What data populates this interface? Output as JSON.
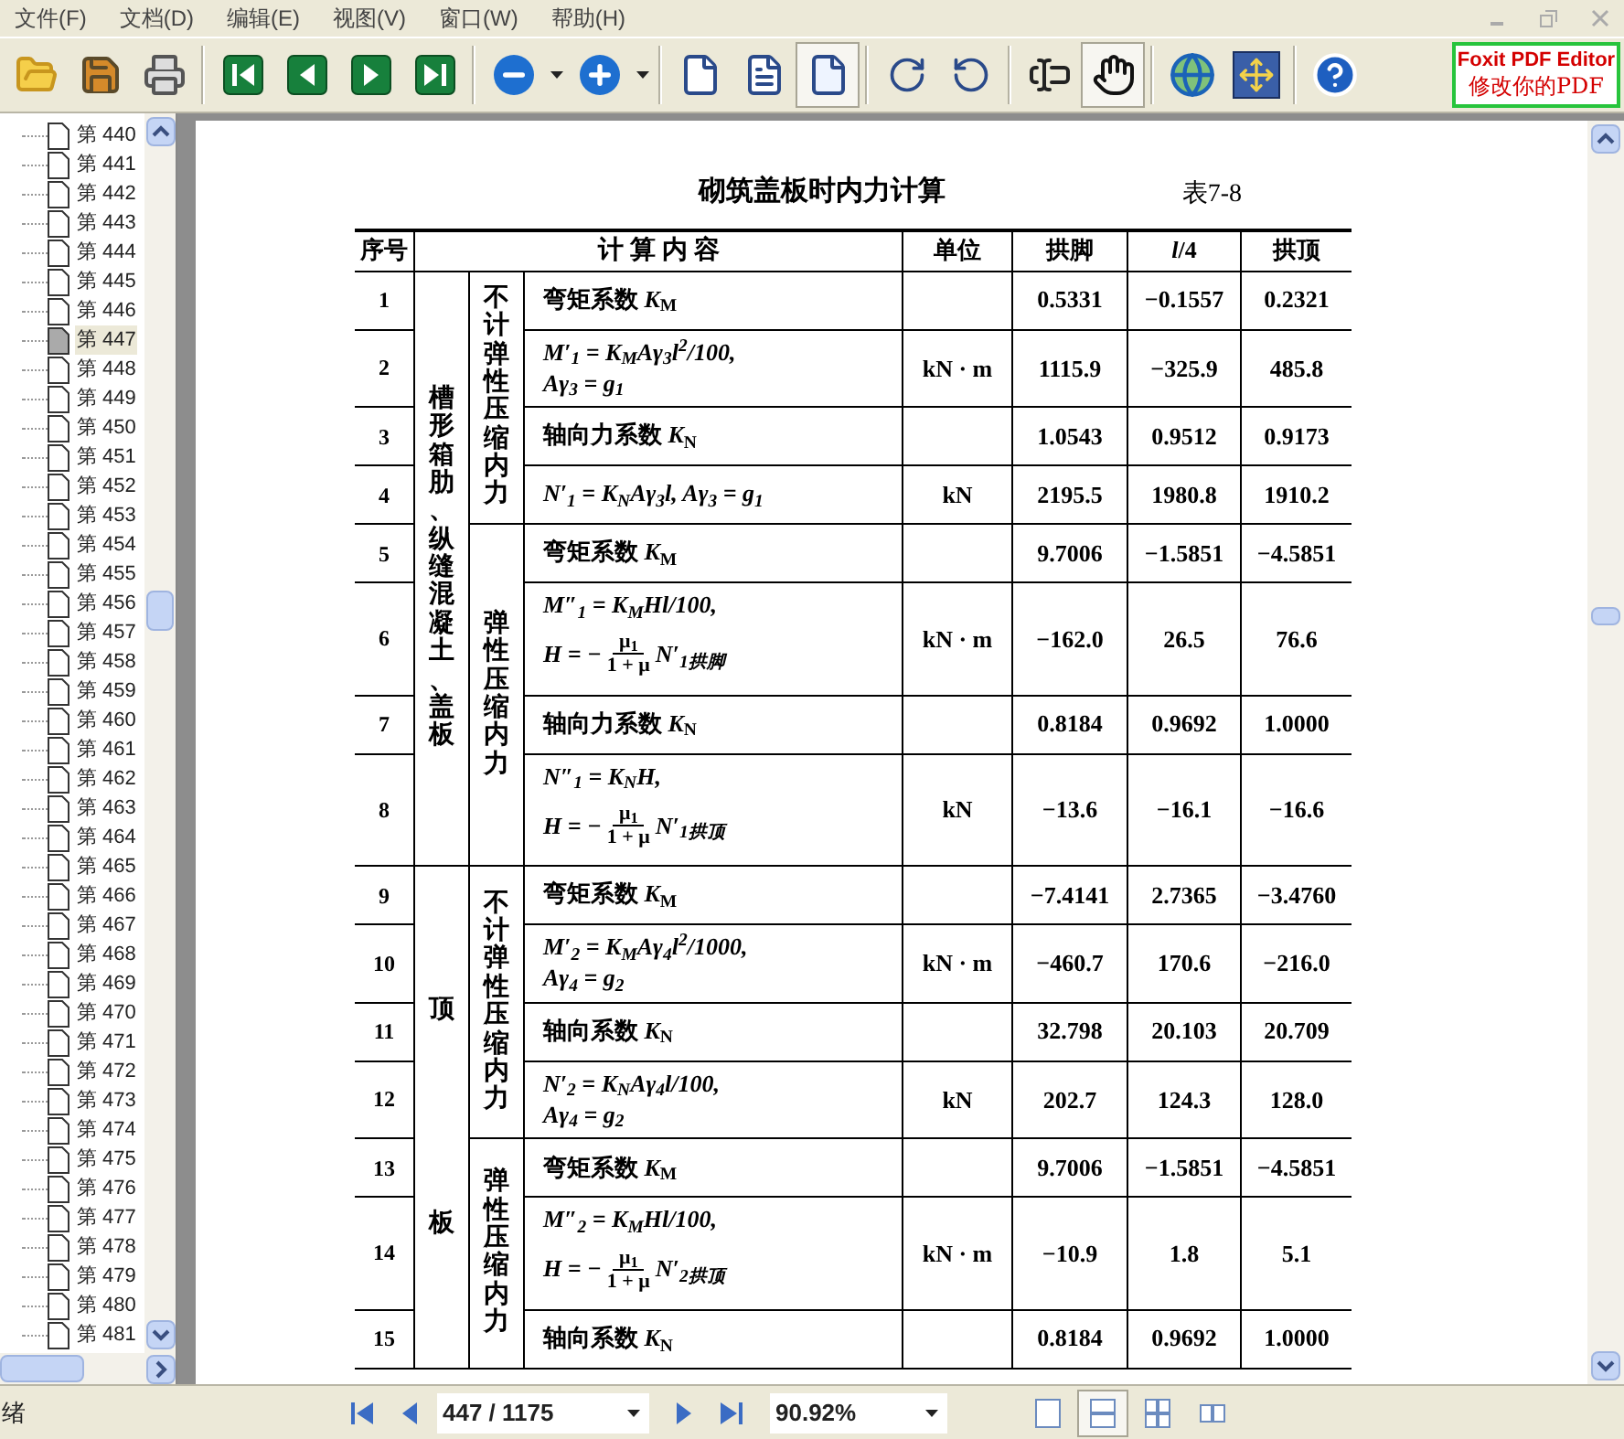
{
  "menu": [
    {
      "label": "文件(F)"
    },
    {
      "label": "文档(D)"
    },
    {
      "label": "编辑(E)"
    },
    {
      "label": "视图(V)"
    },
    {
      "label": "窗口(W)"
    },
    {
      "label": "帮助(H)"
    }
  ],
  "toolbar": [
    {
      "kind": "open",
      "pressed": false
    },
    {
      "kind": "save",
      "pressed": false
    },
    {
      "kind": "print",
      "pressed": false
    },
    {
      "kind": "separator"
    },
    {
      "kind": "first",
      "pressed": false
    },
    {
      "kind": "prev",
      "pressed": false
    },
    {
      "kind": "next",
      "pressed": false
    },
    {
      "kind": "last",
      "pressed": false
    },
    {
      "kind": "separator"
    },
    {
      "kind": "zoom_out",
      "pressed": false
    },
    {
      "kind": "dropdown",
      "pressed": false
    },
    {
      "kind": "zoom_in",
      "pressed": false
    },
    {
      "kind": "dropdown",
      "pressed": false
    },
    {
      "kind": "separator"
    },
    {
      "kind": "actual_size",
      "pressed": false
    },
    {
      "kind": "fit_page",
      "pressed": false
    },
    {
      "kind": "fit_width",
      "pressed": true
    },
    {
      "kind": "separator"
    },
    {
      "kind": "rotate_right",
      "pressed": false
    },
    {
      "kind": "rotate_left",
      "pressed": false
    },
    {
      "kind": "separator"
    },
    {
      "kind": "select_text",
      "pressed": false
    },
    {
      "kind": "hand",
      "pressed": true
    },
    {
      "kind": "separator"
    },
    {
      "kind": "web",
      "pressed": false
    },
    {
      "kind": "snapshot",
      "pressed": false
    },
    {
      "kind": "separator"
    },
    {
      "kind": "help",
      "pressed": false
    }
  ],
  "promo": {
    "title": "Foxit PDF Editor",
    "subtitle": "修改你的PDF"
  },
  "sidebar": {
    "items": [
      {
        "label": "第 440",
        "selected": false
      },
      {
        "label": "第 441",
        "selected": false
      },
      {
        "label": "第 442",
        "selected": false
      },
      {
        "label": "第 443",
        "selected": false
      },
      {
        "label": "第 444",
        "selected": false
      },
      {
        "label": "第 445",
        "selected": false
      },
      {
        "label": "第 446",
        "selected": false
      },
      {
        "label": "第 447",
        "selected": true
      },
      {
        "label": "第 448",
        "selected": false
      },
      {
        "label": "第 449",
        "selected": false
      },
      {
        "label": "第 450",
        "selected": false
      },
      {
        "label": "第 451",
        "selected": false
      },
      {
        "label": "第 452",
        "selected": false
      },
      {
        "label": "第 453",
        "selected": false
      },
      {
        "label": "第 454",
        "selected": false
      },
      {
        "label": "第 455",
        "selected": false
      },
      {
        "label": "第 456",
        "selected": false
      },
      {
        "label": "第 457",
        "selected": false
      },
      {
        "label": "第 458",
        "selected": false
      },
      {
        "label": "第 459",
        "selected": false
      },
      {
        "label": "第 460",
        "selected": false
      },
      {
        "label": "第 461",
        "selected": false
      },
      {
        "label": "第 462",
        "selected": false
      },
      {
        "label": "第 463",
        "selected": false
      },
      {
        "label": "第 464",
        "selected": false
      },
      {
        "label": "第 465",
        "selected": false
      },
      {
        "label": "第 466",
        "selected": false
      },
      {
        "label": "第 467",
        "selected": false
      },
      {
        "label": "第 468",
        "selected": false
      },
      {
        "label": "第 469",
        "selected": false
      },
      {
        "label": "第 470",
        "selected": false
      },
      {
        "label": "第 471",
        "selected": false
      },
      {
        "label": "第 472",
        "selected": false
      },
      {
        "label": "第 473",
        "selected": false
      },
      {
        "label": "第 474",
        "selected": false
      },
      {
        "label": "第 475",
        "selected": false
      },
      {
        "label": "第 476",
        "selected": false
      },
      {
        "label": "第 477",
        "selected": false
      },
      {
        "label": "第 478",
        "selected": false
      },
      {
        "label": "第 479",
        "selected": false
      },
      {
        "label": "第 480",
        "selected": false
      },
      {
        "label": "第 481",
        "selected": false
      }
    ]
  },
  "document": {
    "title": "砌筑盖板时内力计算",
    "table_number": "表7-8",
    "table": {
      "columns": [
        "序号",
        "计 算 内 容",
        "单位",
        "拱脚",
        "*l*/4",
        "拱顶"
      ],
      "groups": [
        {
          "labels": [
            "槽形箱肋、纵缝混凝土、盖板"
          ],
          "subgroups": [
            {
              "label": "不计弹性压缩内力",
              "rows": [
                {
                  "no": "1",
                  "lines": [
                    {
                      "kind": "text",
                      "text": "弯矩系数 *K*$_{M}$"
                    }
                  ],
                  "unit": "",
                  "values": [
                    "0.5331",
                    "−0.1557",
                    "0.2321"
                  ]
                },
                {
                  "no": "2",
                  "lines": [
                    {
                      "kind": "formula",
                      "text": "M′$_{1}$ = K$_{M}$Aγ$_{3}$l$^{2}$/100,"
                    },
                    {
                      "kind": "formula",
                      "text": "Aγ$_{3}$ = g$_{1}$"
                    }
                  ],
                  "unit": "kN · m",
                  "values": [
                    "1115.9",
                    "−325.9",
                    "485.8"
                  ]
                },
                {
                  "no": "3",
                  "lines": [
                    {
                      "kind": "text",
                      "text": "轴向力系数 *K*$_{N}$"
                    }
                  ],
                  "unit": "",
                  "values": [
                    "1.0543",
                    "0.9512",
                    "0.9173"
                  ]
                },
                {
                  "no": "4",
                  "lines": [
                    {
                      "kind": "formula",
                      "text": "N′$_{1}$ = K$_{N}$Aγ$_{3}$l, Aγ$_{3}$ = g$_{1}$"
                    }
                  ],
                  "unit": "kN",
                  "values": [
                    "2195.5",
                    "1980.8",
                    "1910.2"
                  ]
                }
              ]
            },
            {
              "label": "弹性压缩内力",
              "rows": [
                {
                  "no": "5",
                  "lines": [
                    {
                      "kind": "text",
                      "text": "弯矩系数 *K*$_{M}$"
                    }
                  ],
                  "unit": "",
                  "values": [
                    "9.7006",
                    "−1.5851",
                    "−4.5851"
                  ]
                },
                {
                  "no": "6",
                  "lines": [
                    {
                      "kind": "formula",
                      "text": "M″$_{1}$ = K$_{M}$Hl/100,"
                    },
                    {
                      "kind": "fraction",
                      "lhs": "H = −",
                      "num": "μ$_{1}$",
                      "den": "1 + μ",
                      "rhs": "N′$_{1拱脚}$"
                    }
                  ],
                  "unit": "kN · m",
                  "values": [
                    "−162.0",
                    "26.5",
                    "76.6"
                  ]
                },
                {
                  "no": "7",
                  "lines": [
                    {
                      "kind": "text",
                      "text": "轴向力系数 *K*$_{N}$"
                    }
                  ],
                  "unit": "",
                  "values": [
                    "0.8184",
                    "0.9692",
                    "1.0000"
                  ]
                },
                {
                  "no": "8",
                  "lines": [
                    {
                      "kind": "formula",
                      "text": "N″$_{1}$ = K$_{N}$H,"
                    },
                    {
                      "kind": "fraction",
                      "lhs": "H = −",
                      "num": "μ$_{1}$",
                      "den": "1 + μ",
                      "rhs": "N′$_{1拱顶}$"
                    }
                  ],
                  "unit": "kN",
                  "values": [
                    "−13.6",
                    "−16.1",
                    "−16.6"
                  ]
                }
              ]
            }
          ]
        },
        {
          "labels": [
            "顶",
            "板"
          ],
          "subgroups": [
            {
              "label": "不计弹性压缩内力",
              "rows": [
                {
                  "no": "9",
                  "lines": [
                    {
                      "kind": "text",
                      "text": "弯矩系数 *K*$_{M}$"
                    }
                  ],
                  "unit": "",
                  "values": [
                    "−7.4141",
                    "2.7365",
                    "−3.4760"
                  ]
                },
                {
                  "no": "10",
                  "lines": [
                    {
                      "kind": "formula",
                      "text": "M′$_{2}$ = K$_{M}$Aγ$_{4}$l$^{2}$/1000,"
                    },
                    {
                      "kind": "formula",
                      "text": "Aγ$_{4}$ = g$_{2}$"
                    }
                  ],
                  "unit": "kN · m",
                  "values": [
                    "−460.7",
                    "170.6",
                    "−216.0"
                  ]
                },
                {
                  "no": "11",
                  "lines": [
                    {
                      "kind": "text",
                      "text": "轴向系数 *K*$_{N}$"
                    }
                  ],
                  "unit": "",
                  "values": [
                    "32.798",
                    "20.103",
                    "20.709"
                  ]
                },
                {
                  "no": "12",
                  "lines": [
                    {
                      "kind": "formula",
                      "text": "N′$_{2}$ = K$_{N}$Aγ$_{4}$l/100,"
                    },
                    {
                      "kind": "formula",
                      "text": "Aγ$_{4}$ = g$_{2}$"
                    }
                  ],
                  "unit": "kN",
                  "values": [
                    "202.7",
                    "124.3",
                    "128.0"
                  ]
                }
              ]
            },
            {
              "label": "弹性压缩内力",
              "rows": [
                {
                  "no": "13",
                  "lines": [
                    {
                      "kind": "text",
                      "text": "弯矩系数 *K*$_{M}$"
                    }
                  ],
                  "unit": "",
                  "values": [
                    "9.7006",
                    "−1.5851",
                    "−4.5851"
                  ]
                },
                {
                  "no": "14",
                  "lines": [
                    {
                      "kind": "formula",
                      "text": "M″$_{2}$ = K$_{M}$Hl/100,"
                    },
                    {
                      "kind": "fraction",
                      "lhs": "H = −",
                      "num": "μ$_{1}$",
                      "den": "1 + μ",
                      "rhs": "N′$_{2拱顶}$"
                    }
                  ],
                  "unit": "kN · m",
                  "values": [
                    "−10.9",
                    "1.8",
                    "5.1"
                  ]
                },
                {
                  "no": "15",
                  "lines": [
                    {
                      "kind": "text",
                      "text": "轴向系数 *K*$_{N}$"
                    }
                  ],
                  "unit": "",
                  "values": [
                    "0.8184",
                    "0.9692",
                    "1.0000"
                  ]
                }
              ]
            }
          ]
        }
      ]
    }
  },
  "status_bar": {
    "status": "绪",
    "page_field": "447 / 1175",
    "zoom_field": "90.92%",
    "view_modes": [
      {
        "kind": "single",
        "selected": false
      },
      {
        "kind": "continuous",
        "selected": true
      },
      {
        "kind": "continuous_facing",
        "selected": false
      },
      {
        "kind": "facing",
        "selected": false
      }
    ]
  }
}
